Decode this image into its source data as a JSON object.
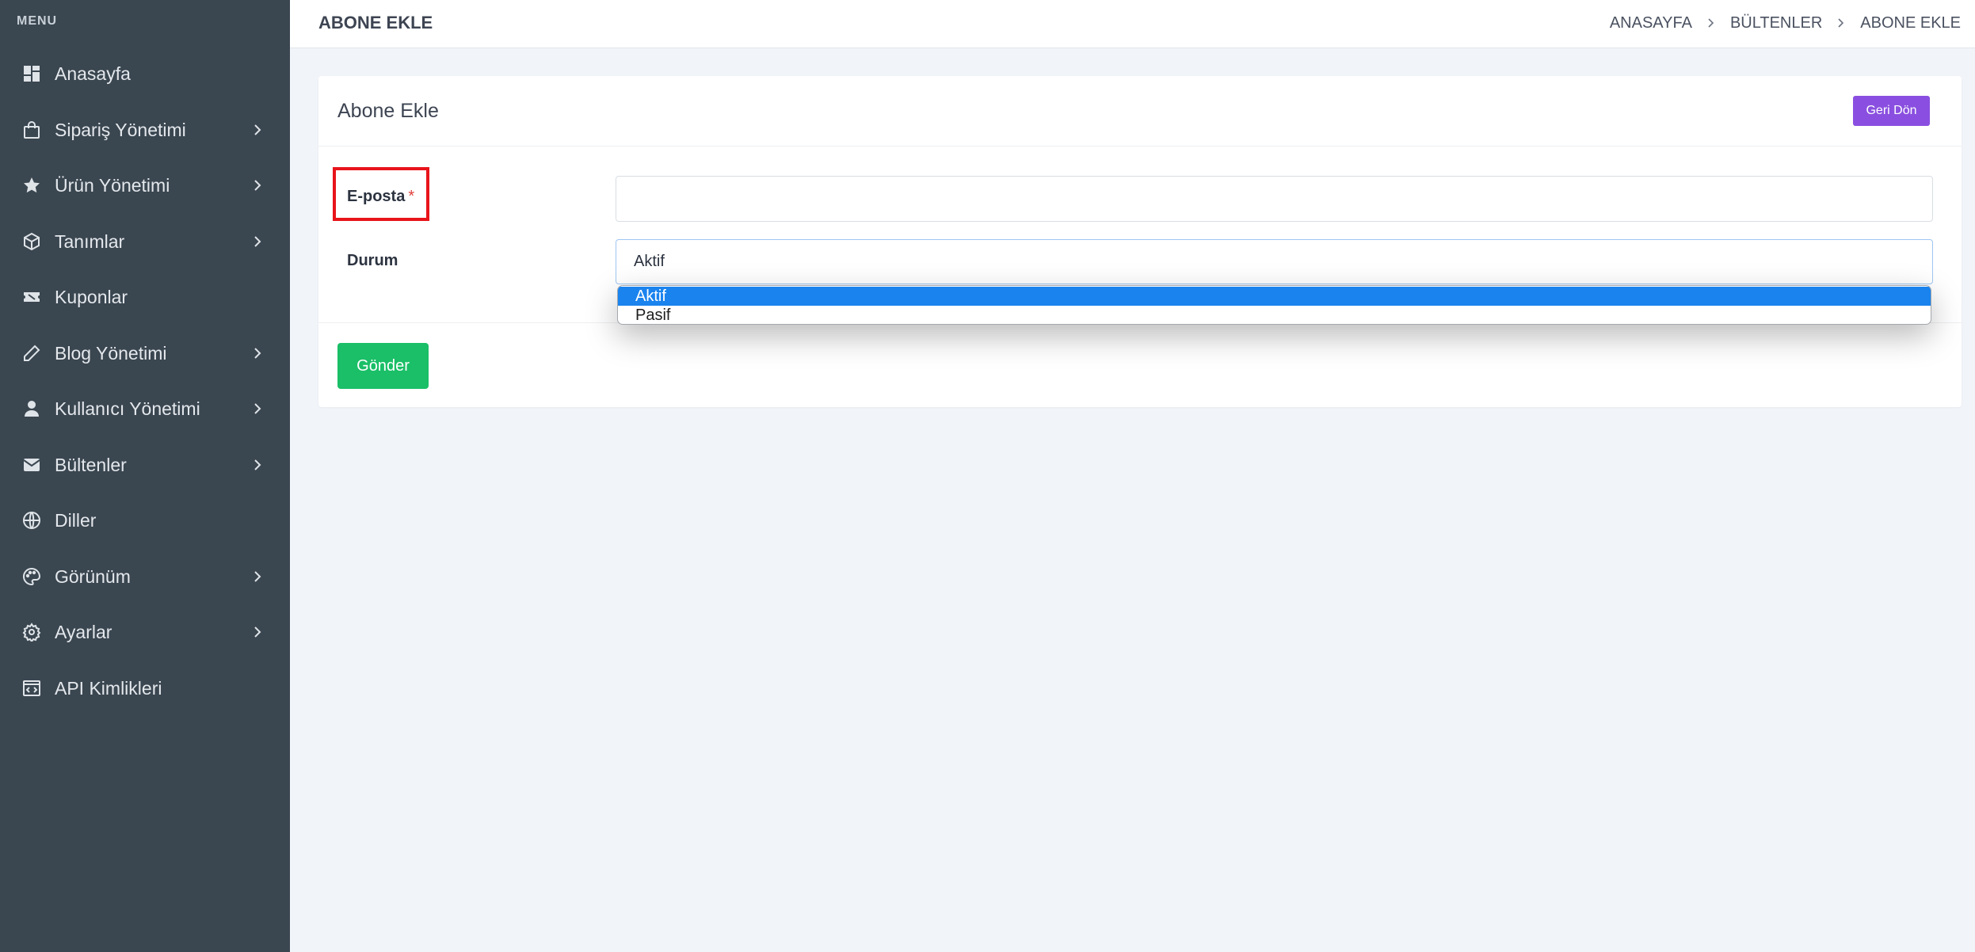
{
  "sidebar": {
    "menu_title": "MENU",
    "items": [
      {
        "label": "Anasayfa",
        "icon": "dashboard-icon",
        "has_children": false
      },
      {
        "label": "Sipariş Yönetimi",
        "icon": "shopping-bag-icon",
        "has_children": true
      },
      {
        "label": "Ürün Yönetimi",
        "icon": "star-icon",
        "has_children": true
      },
      {
        "label": "Tanımlar",
        "icon": "box-icon",
        "has_children": true
      },
      {
        "label": "Kuponlar",
        "icon": "ticket-icon",
        "has_children": false
      },
      {
        "label": "Blog Yönetimi",
        "icon": "pencil-icon",
        "has_children": true
      },
      {
        "label": "Kullanıcı Yönetimi",
        "icon": "user-icon",
        "has_children": true
      },
      {
        "label": "Bültenler",
        "icon": "envelope-icon",
        "has_children": true
      },
      {
        "label": "Diller",
        "icon": "globe-icon",
        "has_children": false
      },
      {
        "label": "Görünüm",
        "icon": "palette-icon",
        "has_children": true
      },
      {
        "label": "Ayarlar",
        "icon": "gear-icon",
        "has_children": true
      },
      {
        "label": "API Kimlikleri",
        "icon": "code-window-icon",
        "has_children": false
      }
    ]
  },
  "header": {
    "title": "ABONE EKLE",
    "breadcrumb": [
      "ANASAYFA",
      "BÜLTENLER",
      "ABONE EKLE"
    ]
  },
  "card": {
    "title": "Abone Ekle",
    "back_button": "Geri Dön",
    "fields": {
      "email_label": "E-posta",
      "required_mark": "*",
      "email_value": "",
      "status_label": "Durum",
      "status_value": "Aktif",
      "status_options": [
        "Aktif",
        "Pasif"
      ]
    },
    "submit_button": "Gönder"
  },
  "colors": {
    "sidebar_bg": "#3a4650",
    "back_button": "#8a4fe0",
    "submit_button": "#1abf67",
    "selected_option": "#1a83ee",
    "highlight": "#e8141a"
  }
}
